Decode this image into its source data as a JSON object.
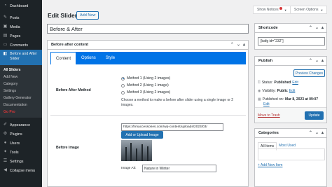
{
  "sidebar": {
    "items": [
      {
        "label": "Dashboard",
        "icon": "dashboard-icon"
      },
      {
        "label": "Posts",
        "icon": "pin-icon"
      },
      {
        "label": "Media",
        "icon": "media-icon"
      },
      {
        "label": "Pages",
        "icon": "page-icon"
      },
      {
        "label": "Comments",
        "icon": "comment-icon"
      }
    ],
    "active": {
      "label": "Before and After Slider",
      "icon": "slider-icon"
    },
    "submenu": [
      "All Sliders",
      "Add New",
      "Category",
      "Settings",
      "Gallery Generator",
      "Documentation",
      "Go Pro"
    ],
    "lower_items": [
      {
        "label": "Appearance",
        "icon": "brush-icon"
      },
      {
        "label": "Plugins",
        "icon": "plugin-icon"
      },
      {
        "label": "Users",
        "icon": "users-icon"
      },
      {
        "label": "Tools",
        "icon": "tools-icon"
      },
      {
        "label": "Settings",
        "icon": "settings-icon"
      },
      {
        "label": "Collapse menu",
        "icon": "collapse-icon"
      }
    ]
  },
  "header": {
    "title": "Edit Slider",
    "add_new": "Add New",
    "show_notices": "Show Notices",
    "screen_options": "Screen Options"
  },
  "post_title": "Before & After",
  "main_box": {
    "title": "Before after content",
    "tabs": [
      "Content",
      "Options",
      "Style"
    ],
    "method_label": "Before After Method",
    "methods": [
      "Method 1 (Using 2 images)",
      "Method 2 (Using 1 image)",
      "Method 3 (Using 2 images)"
    ],
    "method_help": "Choose a method to make a before after slider using a single image or 2 images.",
    "before_image_label": "Before Image",
    "image_url": "https://hmaccessories.com/wp-content/uploads/2023/03/",
    "upload_button": "Add or Upload Image",
    "alt_label": "Image Alt:",
    "alt_value": "Nature in Winter"
  },
  "shortcode_box": {
    "title": "Shortcode",
    "value": "[bafg id=\"232\"]"
  },
  "publish_box": {
    "title": "Publish",
    "preview": "Preview Changes",
    "status_label": "Status:",
    "status_value": "Published",
    "visibility_label": "Visibility:",
    "visibility_value": "Public",
    "published_label": "Published on:",
    "published_value": "Mar 8, 2023 at 09:07",
    "edit": "Edit",
    "trash": "Move to Trash",
    "update": "Update"
  },
  "categories_box": {
    "title": "Categories",
    "tab_all": "All Items",
    "tab_most_used": "Most Used",
    "add_new": "+ Add New Item"
  },
  "colors": {
    "sidebar_bg": "#1d2327",
    "accent": "#2271b1",
    "tab_bar": "#0073e6",
    "go_pro": "#d63638"
  }
}
